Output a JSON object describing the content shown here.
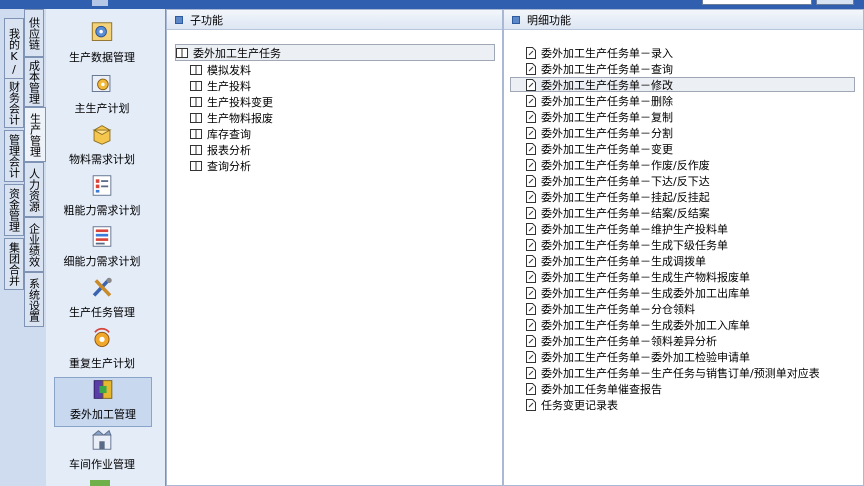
{
  "left_tabs": [
    {
      "label": "我的K/3"
    },
    {
      "label": "供应链"
    },
    {
      "label": "成本管理"
    },
    {
      "label": "财务会计"
    },
    {
      "label": "生产管理"
    },
    {
      "label": "管理会计"
    },
    {
      "label": "人力资源"
    },
    {
      "label": "资金管理"
    },
    {
      "label": "企业绩效"
    },
    {
      "label": "集团合并"
    },
    {
      "label": "系统设置"
    }
  ],
  "nav_items": [
    {
      "label": "生产数据管理",
      "icon": "gear-database-icon"
    },
    {
      "label": "主生产计划",
      "icon": "gear-plan-icon"
    },
    {
      "label": "物料需求计划",
      "icon": "material-box-icon"
    },
    {
      "label": "粗能力需求计划",
      "icon": "capacity-list-icon"
    },
    {
      "label": "细能力需求计划",
      "icon": "detail-capacity-icon"
    },
    {
      "label": "生产任务管理",
      "icon": "tools-icon"
    },
    {
      "label": "重复生产计划",
      "icon": "repeat-gear-icon"
    },
    {
      "label": "委外加工管理",
      "icon": "outsource-icon"
    },
    {
      "label": "车间作业管理",
      "icon": "workshop-icon"
    }
  ],
  "sub_panel": {
    "title": "子功能",
    "items": [
      "委外加工生产任务",
      "模拟发料",
      "生产投料",
      "生产投料变更",
      "生产物料报废",
      "库存查询",
      "报表分析",
      "查询分析"
    ]
  },
  "detail_panel": {
    "title": "明细功能",
    "items": [
      "委外加工生产任务单－录入",
      "委外加工生产任务单－查询",
      "委外加工生产任务单－修改",
      "委外加工生产任务单－删除",
      "委外加工生产任务单－复制",
      "委外加工生产任务单－分割",
      "委外加工生产任务单－变更",
      "委外加工生产任务单－作废/反作废",
      "委外加工生产任务单－下达/反下达",
      "委外加工生产任务单－挂起/反挂起",
      "委外加工生产任务单－结案/反结案",
      "委外加工生产任务单－维护生产投料单",
      "委外加工生产任务单－生成下级任务单",
      "委外加工生产任务单－生成调拨单",
      "委外加工生产任务单－生成生产物料报废单",
      "委外加工生产任务单－生成委外加工出库单",
      "委外加工生产任务单－分仓领料",
      "委外加工生产任务单－生成委外加工入库单",
      "委外加工生产任务单－领料差异分析",
      "委外加工生产任务单－委外加工检验申请单",
      "委外加工生产任务单－生产任务与销售订单/预测单对应表",
      "委外加工任务单催查报告",
      "任务变更记录表"
    ]
  },
  "colors": {
    "titlebar": "#2f5fae",
    "panel_bg": "#cfdcf0",
    "nav_bg": "#e4ecf8",
    "selection": "#c8d8ef"
  }
}
